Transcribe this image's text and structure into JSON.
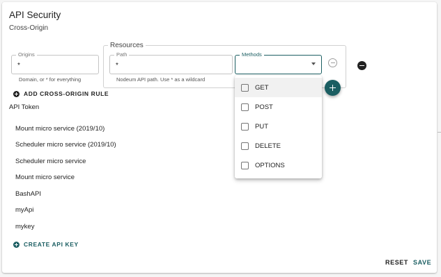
{
  "colors": {
    "accent": "#1b5e62",
    "text": "#212121"
  },
  "page": {
    "title": "API Security",
    "subtitle": "Cross-Origin"
  },
  "origins": {
    "label": "Origins",
    "value": "*",
    "helper": "Domain, or  * for everything"
  },
  "resources": {
    "legend": "Resources",
    "path": {
      "label": "Path",
      "value": "*",
      "helper": "Nodeum API path. Use  * as a wildcard"
    },
    "methods": {
      "label": "Methods",
      "value": ""
    }
  },
  "icons": {
    "remove_inline": "remove-circle-outline-icon",
    "remove_rule": "remove-circle-icon",
    "add": "add-circle-icon",
    "dropdown": "arrow-drop-down-icon"
  },
  "add_rule_label": "ADD CROSS-ORIGIN RULE",
  "api_token": {
    "title": "API Token",
    "items": [
      "Mount micro service (2019/10)",
      "Scheduler micro service (2019/10)",
      "Scheduler micro service",
      "Mount micro service",
      "BashAPI",
      "myApi",
      "mykey"
    ],
    "create_label": "CREATE API KEY"
  },
  "actions": {
    "reset": "RESET",
    "save": "SAVE"
  },
  "methods_menu": {
    "options": [
      "GET",
      "POST",
      "PUT",
      "DELETE",
      "OPTIONS"
    ],
    "highlighted": "GET"
  }
}
